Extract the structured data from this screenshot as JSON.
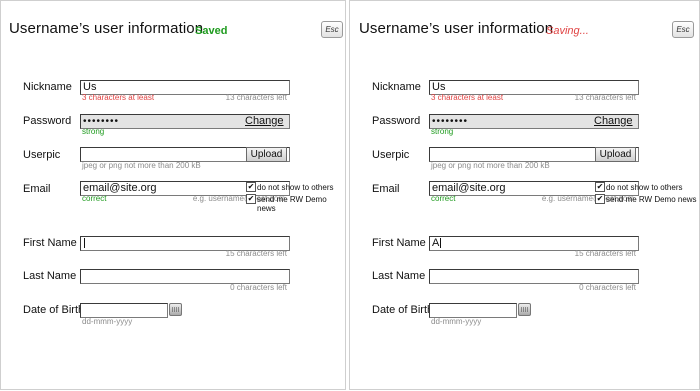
{
  "panels": [
    {
      "title": "Username’s user information",
      "status": "Saved",
      "esc_label": "Esc",
      "nickname": {
        "label": "Nickname",
        "value": "Us",
        "error": "3 characters at least",
        "counter": "13 characters left"
      },
      "password": {
        "label": "Password",
        "value": "••••••••",
        "strength": "strong",
        "change_label": "Change"
      },
      "userpic": {
        "label": "Userpic",
        "value": "",
        "hint": "jpeg or png not more than 200 kB",
        "upload_label": "Upload"
      },
      "email": {
        "label": "Email",
        "value": "email@site.org",
        "status": "correct",
        "example": "e.g. username@post.dom",
        "checkbox1": "do not show to others",
        "checkbox2": "send me RW Demo news"
      },
      "first_name": {
        "label": "First Name",
        "value": "",
        "counter": "15 characters left"
      },
      "last_name": {
        "label": "Last Name",
        "value": "",
        "counter": "0 characters left"
      },
      "dob": {
        "label": "Date of Birth",
        "value": "",
        "format": "dd-mmm-yyyy"
      }
    },
    {
      "title": "Username’s user information",
      "status": "Saving...",
      "esc_label": "Esc",
      "nickname": {
        "label": "Nickname",
        "value": "Us",
        "error": "3 characters at least",
        "counter": "13 characters left"
      },
      "password": {
        "label": "Password",
        "value": "••••••••",
        "strength": "strong",
        "change_label": "Change"
      },
      "userpic": {
        "label": "Userpic",
        "value": "",
        "hint": "jpeg or png not more than 200 kB",
        "upload_label": "Upload"
      },
      "email": {
        "label": "Email",
        "value": "email@site.org",
        "status": "correct",
        "example": "e.g. username@post.dom",
        "checkbox1": "do not show to others",
        "checkbox2": "send me RW Demo news"
      },
      "first_name": {
        "label": "First Name",
        "value": "A",
        "counter": "15 characters left"
      },
      "last_name": {
        "label": "Last Name",
        "value": "",
        "counter": "0 characters left"
      },
      "dob": {
        "label": "Date of Birth",
        "value": "",
        "format": "dd-mmm-yyyy"
      }
    }
  ],
  "colors": {
    "saved": "#1e9b1e",
    "saving": "#e04343",
    "error": "#e04343",
    "ok": "#1e9b1e",
    "hint": "#8c8c8c"
  },
  "icons": {
    "checkbox_checked": "check-icon",
    "calendar": "calendar-icon"
  }
}
